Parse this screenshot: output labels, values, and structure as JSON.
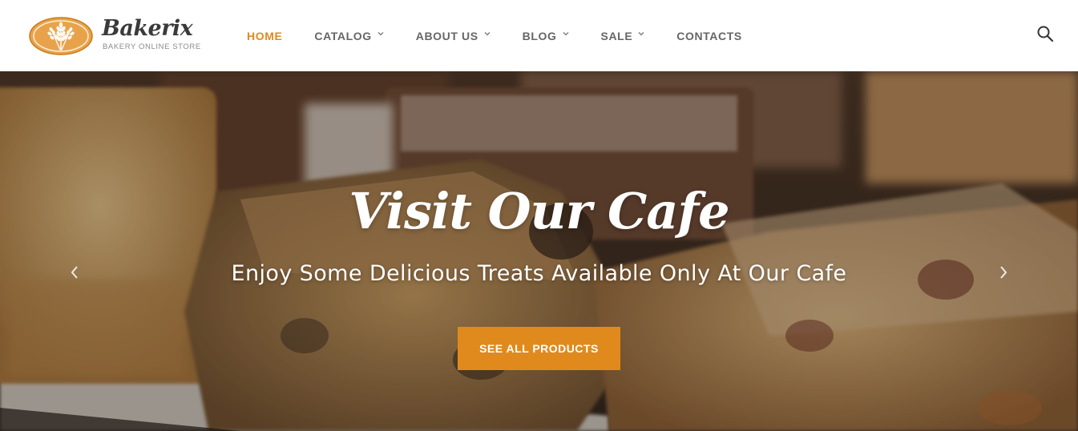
{
  "brand": {
    "name": "Bakerix",
    "tagline": "BAKERY ONLINE STORE",
    "logo_icon": "wheat-icon"
  },
  "nav": {
    "items": [
      {
        "label": "HOME",
        "active": true,
        "has_dropdown": false
      },
      {
        "label": "CATALOG",
        "active": false,
        "has_dropdown": true
      },
      {
        "label": "ABOUT US",
        "active": false,
        "has_dropdown": true
      },
      {
        "label": "BLOG",
        "active": false,
        "has_dropdown": true
      },
      {
        "label": "SALE",
        "active": false,
        "has_dropdown": true
      },
      {
        "label": "CONTACTS",
        "active": false,
        "has_dropdown": false
      }
    ],
    "search_icon": "search-icon"
  },
  "hero": {
    "title": "Visit Our Cafe",
    "subtitle": "Enjoy Some Delicious Treats Available Only At Our Cafe",
    "cta_label": "SEE ALL PRODUCTS",
    "prev_icon": "chevron-left-icon",
    "next_icon": "chevron-right-icon"
  },
  "colors": {
    "accent": "#e08a1e",
    "nav_text": "#666666",
    "brand_text": "#3a3a3a",
    "hero_text": "#ffffff"
  }
}
